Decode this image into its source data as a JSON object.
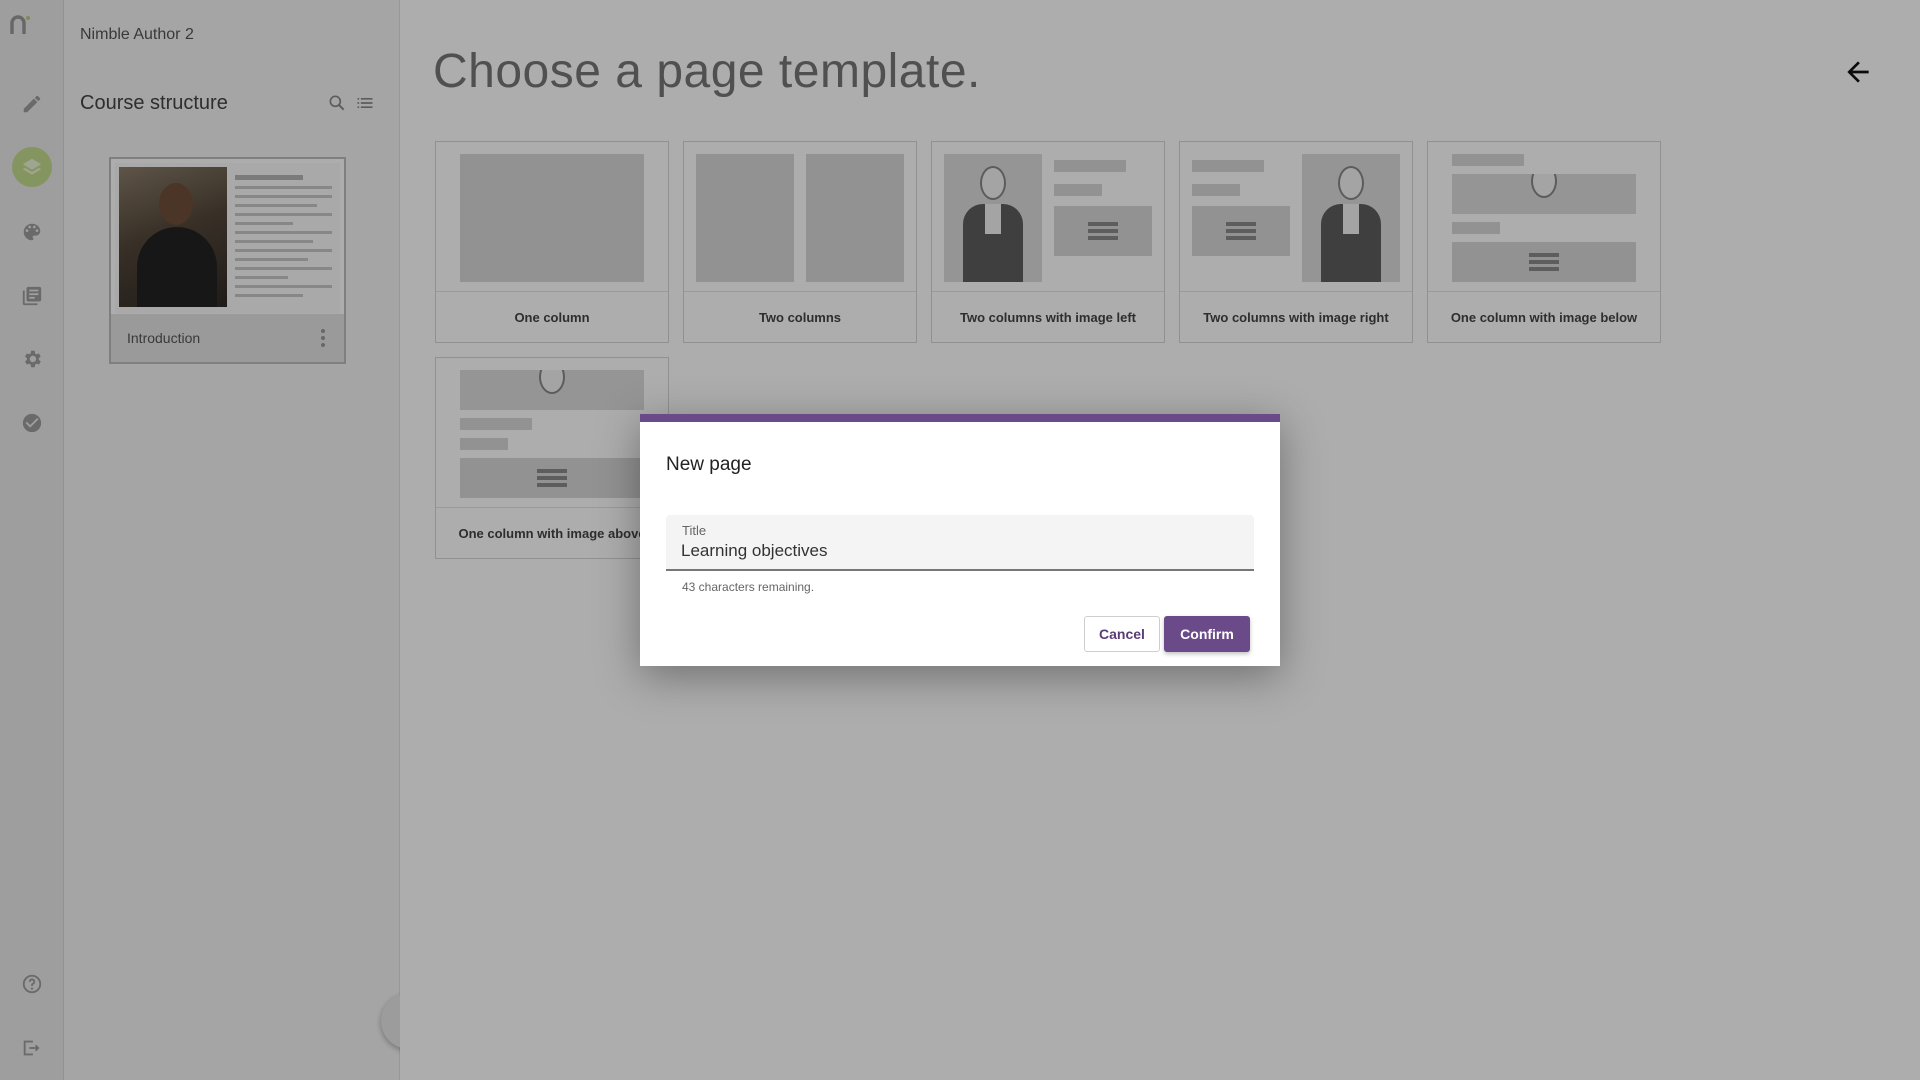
{
  "app": {
    "name": "Nimble Author 2"
  },
  "sidebar": {
    "title": "Course structure",
    "pages": [
      {
        "label": "Introduction"
      }
    ],
    "add_label": "+"
  },
  "main": {
    "heading": "Choose a page template.",
    "templates": [
      {
        "label": "One column"
      },
      {
        "label": "Two columns"
      },
      {
        "label": "Two columns with image left"
      },
      {
        "label": "Two columns with image right"
      },
      {
        "label": "One column with image below"
      },
      {
        "label": "One column with image above"
      }
    ]
  },
  "dialog": {
    "title": "New page",
    "field_label": "Title",
    "field_value": "Learning objectives",
    "hint": "43 characters remaining.",
    "cancel_label": "Cancel",
    "confirm_label": "Confirm"
  },
  "colors": {
    "accent": "#6b4a8a",
    "active_nav": "#c5dc8e"
  },
  "icons": {
    "rail": [
      "logo-icon",
      "pencil-icon",
      "layers-icon",
      "palette-icon",
      "library-icon",
      "gear-icon",
      "check-circle-icon",
      "help-icon",
      "logout-icon"
    ],
    "panel": [
      "search-icon",
      "list-icon",
      "more-vert-icon"
    ],
    "main": [
      "arrow-left-icon"
    ]
  }
}
